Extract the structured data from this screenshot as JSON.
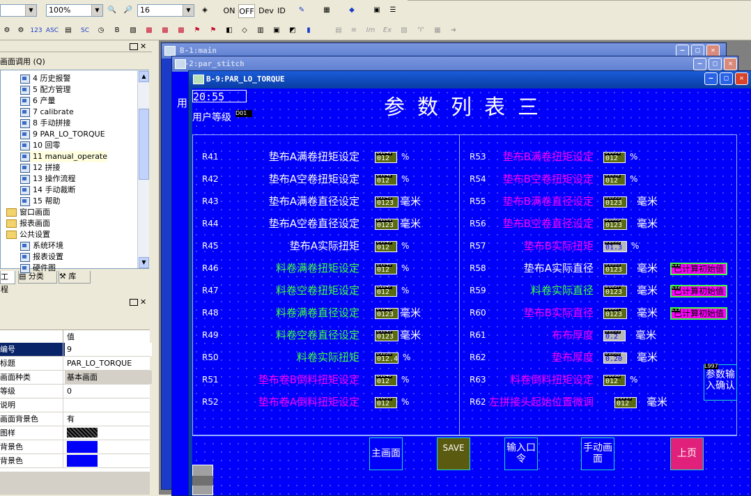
{
  "toolbar": {
    "zoom": "100%",
    "font_size": "16",
    "on_label": "ON",
    "off_label": "OFF",
    "dev_label": "Dev",
    "id_label": "ID",
    "row2_text": [
      "123",
      "ASC",
      "SC"
    ]
  },
  "project_panel": {
    "header": "画面调用 (Q)",
    "items": [
      {
        "label": "4 历史报警",
        "type": "screen"
      },
      {
        "label": "5 配方管理",
        "type": "screen"
      },
      {
        "label": "6 产量",
        "type": "screen"
      },
      {
        "label": "7 calibrate",
        "type": "screen"
      },
      {
        "label": "8 手动拼接",
        "type": "screen"
      },
      {
        "label": "9 PAR_LO_TORQUE",
        "type": "screen"
      },
      {
        "label": "10 回零",
        "type": "screen"
      },
      {
        "label": "11 manual_operate",
        "type": "screen"
      },
      {
        "label": "12 拼接",
        "type": "screen"
      },
      {
        "label": "13 操作流程",
        "type": "screen"
      },
      {
        "label": "14 手动裁断",
        "type": "screen"
      },
      {
        "label": "15 帮助",
        "type": "screen"
      },
      {
        "label": "窗口画面",
        "type": "folder"
      },
      {
        "label": "报表画面",
        "type": "folder"
      },
      {
        "label": "公共设置",
        "type": "folder"
      },
      {
        "label": "系统环境",
        "type": "item"
      },
      {
        "label": "报表设置",
        "type": "item"
      },
      {
        "label": "硬件图",
        "type": "item"
      }
    ],
    "tabs": [
      "工程",
      "分类",
      "库"
    ]
  },
  "properties_panel": {
    "column_header": "值",
    "rows": [
      {
        "key": "编号",
        "value": "9"
      },
      {
        "key": "标题",
        "value": "PAR_LO_TORQUE"
      },
      {
        "key": "画面种类",
        "value": "基本画面"
      },
      {
        "key": "等级",
        "value": "0"
      },
      {
        "key": "说明",
        "value": ""
      },
      {
        "key": "画面背景色",
        "value": "有"
      },
      {
        "key": "图样",
        "value": ""
      },
      {
        "key": "背景色",
        "value": ""
      },
      {
        "key": "背景色",
        "value": ""
      }
    ]
  },
  "windows": {
    "main_title": "B-1:main",
    "stitch_title": "B-2:par_stitch",
    "active_title": "B-9:PAR_LO_TORQUE"
  },
  "screen": {
    "time": "20:55",
    "user_level_label": "用户等级",
    "user_level_tag": "D01",
    "side_text": "用",
    "title": "参数列表三",
    "colors": {
      "bg": "#0000fa",
      "white": "#ffffff",
      "green": "#40ff40",
      "magenta": "#ff00ff"
    },
    "left_rows": [
      {
        "code": "R41",
        "label": "垫布A满卷扭矩设定",
        "color": "#ffffff",
        "tag": "D1041",
        "value": "012",
        "unit": "%"
      },
      {
        "code": "R42",
        "label": "垫布A空卷扭矩设定",
        "color": "#ffffff",
        "tag": "D1042",
        "value": "012",
        "unit": "%"
      },
      {
        "code": "R43",
        "label": "垫布A满卷直径设定",
        "color": "#ffffff",
        "tag": "D1043",
        "value": "0123",
        "unit": "毫米"
      },
      {
        "code": "R44",
        "label": "垫布A空卷直径设定",
        "color": "#ffffff",
        "tag": "D1061",
        "value": "0123",
        "unit": "毫米"
      },
      {
        "code": "R45",
        "label": "垫布A实际扭矩",
        "color": "#ffffff",
        "tag": "D1045",
        "value": "012",
        "unit": "%"
      },
      {
        "code": "R46",
        "label": "料卷满卷扭矩设定",
        "color": "#40ff40",
        "tag": "D1046",
        "value": "012",
        "unit": "%"
      },
      {
        "code": "R47",
        "label": "料卷空卷扭矩设定",
        "color": "#40ff40",
        "tag": "D1047",
        "value": "012",
        "unit": "%"
      },
      {
        "code": "R48",
        "label": "料卷满卷直径设定",
        "color": "#40ff40",
        "tag": "D1048",
        "value": "0123",
        "unit": "毫米"
      },
      {
        "code": "R49",
        "label": "料卷空卷直径设定",
        "color": "#40ff40",
        "tag": "D1049",
        "value": "0123",
        "unit": "毫米"
      },
      {
        "code": "R50",
        "label": "料卷实际扭矩",
        "color": "#40ff40",
        "tag": "D1050",
        "value": "012.4",
        "unit": "%"
      },
      {
        "code": "R51",
        "label": "垫布卷B倒料扭矩设定",
        "color": "#ff00ff",
        "tag": "D1046",
        "value": "012",
        "unit": "%"
      },
      {
        "code": "R52",
        "label": "垫布卷A倒料扭矩设定",
        "color": "#ff00ff",
        "tag": "D1039",
        "value": "012",
        "unit": "%"
      }
    ],
    "right_rows": [
      {
        "code": "R53",
        "label": "垫布B满卷扭矩设定",
        "color": "#ff00ff",
        "tag": "D1051",
        "value": "012",
        "unit": "%"
      },
      {
        "code": "R54",
        "label": "垫布B空卷扭矩设定",
        "color": "#ff00ff",
        "tag": "D1052",
        "value": "012",
        "unit": "%"
      },
      {
        "code": "R55",
        "label": "垫布B满卷直径设定",
        "color": "#ff00ff",
        "tag": "D1053",
        "value": "0123",
        "unit": "毫米"
      },
      {
        "code": "R56",
        "label": "垫布B空卷直径设定",
        "color": "#ff00ff",
        "tag": "D1063",
        "value": "0123",
        "unit": "毫米"
      },
      {
        "code": "R57",
        "label": "垫布B实际扭矩",
        "color": "#ff00ff",
        "tag": "D1055",
        "value": "01.3",
        "unit": "%"
      },
      {
        "code": "R58",
        "label": "垫布A实际直径",
        "color": "#ffffff",
        "tag": "D1065",
        "value": "0123",
        "unit": "毫米",
        "action": "已计算初始值"
      },
      {
        "code": "R59",
        "label": "料卷实际直径",
        "color": "#40ff40",
        "tag": "D1057",
        "value": "0123",
        "unit": "毫米",
        "action": "已计算初始值"
      },
      {
        "code": "R60",
        "label": "垫布B实际直径",
        "color": "#ff00ff",
        "tag": "D1067",
        "value": "0123",
        "unit": "毫米",
        "action": "已计算初始值"
      },
      {
        "code": "R61",
        "label": "布布厚度",
        "color": "#ff00ff",
        "tag": "D1059",
        "value": "0.2",
        "unit": "毫米"
      },
      {
        "code": "R62",
        "label": "垫布厚度",
        "color": "#ff00ff",
        "tag": "D1060",
        "value": "0.20",
        "unit": "毫米"
      },
      {
        "code": "R63",
        "label": "料卷倒料扭矩设定",
        "color": "#ff00ff",
        "tag": "D1038",
        "value": "012",
        "unit": "%"
      },
      {
        "code": "R62",
        "label": "左拼接头起始位置微调",
        "color": "#ff00ff",
        "tag": "D1015",
        "value": "012",
        "unit": "毫米"
      }
    ],
    "action_tags": [
      "L11",
      "L12",
      "L13"
    ],
    "confirm_button": {
      "tag": "L997",
      "label": "参数输入确认"
    },
    "bottom_buttons": [
      {
        "label": "主画面",
        "bg": "#0000fa"
      },
      {
        "label": "SAVE",
        "bg": "#5a5a10"
      },
      {
        "label": "输入口令",
        "bg": "#0000fa"
      },
      {
        "label": "手动画面",
        "bg": "#0000fa"
      },
      {
        "label": "上页",
        "bg": "#e0207a"
      }
    ]
  }
}
